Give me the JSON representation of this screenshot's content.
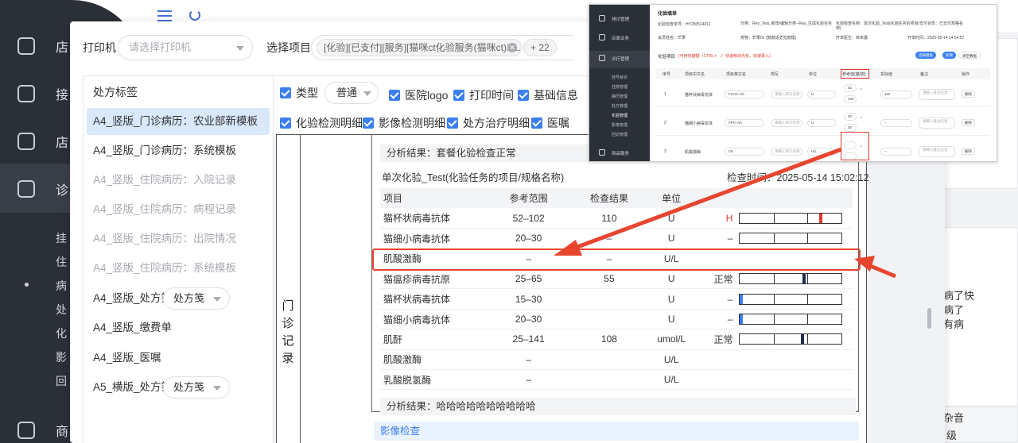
{
  "background": {
    "sidebar_items": [
      {
        "label": "店",
        "icon": "monitor-icon"
      },
      {
        "label": "接",
        "icon": "clipboard-icon"
      },
      {
        "label": "店",
        "icon": "home-icon"
      },
      {
        "label": "诊",
        "icon": "medical-kit-icon"
      }
    ],
    "sidebar_subitems": [
      "挂",
      "住",
      "病",
      "处",
      "化",
      "影",
      "回"
    ],
    "sidebar_bottom": {
      "label": "商",
      "icon": "bag-icon"
    },
    "right_texts": [
      "病了快",
      "病了",
      "有病",
      "杂音",
      "级"
    ]
  },
  "dialog": {
    "printer_label": "打印机",
    "printer_placeholder": "请选择打印机",
    "project_label": "选择项目",
    "project_tag": "[化验][已支付][服务][猫咪ct化验服务(猫咪ct)X1...",
    "project_more": "+ 22",
    "left_panel": {
      "title": "处方标签",
      "items": [
        {
          "label": "A4_竖版_门诊病历：农业部新模板",
          "state": "active"
        },
        {
          "label": "A4_竖版_门诊病历：系统模板",
          "state": "normal"
        },
        {
          "label": "A4_竖版_住院病历：入院记录",
          "state": "disabled"
        },
        {
          "label": "A4_竖版_住院病历：病程记录",
          "state": "disabled"
        },
        {
          "label": "A4_竖版_住院病历：出院情况",
          "state": "disabled"
        },
        {
          "label": "A4_竖版_住院病历：系统模板",
          "state": "disabled"
        },
        {
          "label": "A4_竖版_处方笺",
          "state": "normal",
          "select": "处方笺"
        },
        {
          "label": "A4_竖版_缴费单",
          "state": "normal"
        },
        {
          "label": "A4_竖版_医嘱",
          "state": "normal"
        },
        {
          "label": "A5_横版_处方笺",
          "state": "normal",
          "select": "处方笺"
        }
      ]
    },
    "options_row1": {
      "type_label": "类型",
      "type_value": "普通",
      "hospital_logo": "医院logo",
      "print_time": "打印时间",
      "basic_info": "基础信息"
    },
    "options_row2": {
      "lab_detail": "化验检测明细",
      "imaging_detail": "影像检测明细",
      "treatment_detail": "处方治疗明细",
      "orders": "医嘱"
    }
  },
  "preview": {
    "vertical_label": [
      "门",
      "诊",
      "记",
      "录"
    ],
    "analysis_top": "分析结果：套餐化验检查正常",
    "single_title": "单次化验_Test(化验任务的项目/规格名称)",
    "check_time": "检查时间：2025-05-14 15:02:12",
    "table_headers": {
      "name": "项目",
      "ref": "参考范围",
      "result": "检查结果",
      "unit": "单位"
    },
    "rows": [
      {
        "name": "猫杯状病毒抗体",
        "ref": "52–102",
        "result": "110",
        "unit": "U",
        "flag": "H",
        "bar": true,
        "mark_pos": 0.78,
        "mark_color": "#e03a2f"
      },
      {
        "name": "猫细小病毒抗体",
        "ref": "20–30",
        "result": "–",
        "unit": "U",
        "flag": "–",
        "bar": true,
        "mark_pos": null,
        "mark_color": ""
      },
      {
        "name": "肌酸激酶",
        "ref": "–",
        "result": "–",
        "unit": "U/L",
        "flag": "",
        "bar": false,
        "mark_pos": null,
        "mark_color": ""
      },
      {
        "name": "猫瘟疹病毒抗原",
        "ref": "25–65",
        "result": "55",
        "unit": "U",
        "flag": "正常",
        "bar": true,
        "mark_pos": 0.61,
        "mark_color": "#1f2d4d"
      },
      {
        "name": "猫杯状病毒抗体",
        "ref": "15–30",
        "result": "",
        "unit": "U",
        "flag": "–",
        "bar": true,
        "mark_pos": 0.0,
        "mark_color": "#3b7ff0"
      },
      {
        "name": "猫细小病毒抗体",
        "ref": "20–30",
        "result": "",
        "unit": "U",
        "flag": "–",
        "bar": true,
        "mark_pos": 0.0,
        "mark_color": "#3b7ff0"
      },
      {
        "name": "肌酐",
        "ref": "25–141",
        "result": "108",
        "unit": "umol/L",
        "flag": "正常",
        "bar": true,
        "mark_pos": 0.6,
        "mark_color": "#1f2d4d"
      },
      {
        "name": "肌酸激酶",
        "ref": "–",
        "result": "",
        "unit": "U/L",
        "flag": "",
        "bar": false,
        "mark_pos": null,
        "mark_color": ""
      },
      {
        "name": "乳酸脱氢酶",
        "ref": "–",
        "result": "",
        "unit": "U/L",
        "flag": "",
        "bar": false,
        "mark_pos": null,
        "mark_color": ""
      }
    ],
    "analysis_bottom": "分析结果：哈哈哈哈哈哈哈哈哈哈",
    "imaging_section": "影像检查"
  },
  "inset": {
    "sidebar": [
      "排诊管理",
      "店面业务",
      "诊疗管理",
      "商品服务"
    ],
    "sidebar_sub": [
      "挂号就诊",
      "住院管理",
      "病历管理",
      "处方管理",
      "化验管理",
      "影像管理",
      "回访管理"
    ],
    "title": "化验填单",
    "info": {
      "no": "化验检查单号：HY250514011",
      "category": "分类：Rey_Test_新增/编辑分类--Rey_生成化验任务",
      "name_label": "化验检查名称：单次化验_Test(化验任务的项目/支付状态：已支付规格名称)",
      "pet_owner": "会员姓名：芒果",
      "pet": "宠物：芒果01 (鼓鼓适史犯鼓蜡)",
      "doctor": "开单医生：西米露",
      "time": "开单时间：2025-05-14 14:54:57"
    },
    "section": "化验项目",
    "hint": "(可用快捷键（CTRL+↑ ↓）快速移动光标，快速录入)",
    "btn_template": "选择模板",
    "btn_add": "新增",
    "btn_clear": "清空数据",
    "headers": [
      "序号",
      "项目中文名",
      "项目英文名",
      "简写",
      "单位",
      "参考值(猫/狗)",
      "实际值",
      "备注",
      "操作"
    ],
    "rows": [
      {
        "idx": "1",
        "cn": "猫杯状病毒抗体",
        "en": "FCAV–Ab",
        "abbr": "请输入简写名称",
        "unit": "U",
        "ref_lo": "52",
        "ref_hi": "102",
        "val": "110",
        "note": "请输入备注信息",
        "op": "删除"
      },
      {
        "idx": "2",
        "cn": "猫细小病毒抗体",
        "en": "FPV–Ab",
        "abbr": "请输入简写名称",
        "unit": "U",
        "ref_lo": "20",
        "ref_hi": "30",
        "val": "–",
        "note": "请输入备注信息",
        "op": "删除"
      },
      {
        "idx": "3",
        "cn": "肌酸激酶",
        "en": "CK",
        "abbr": "请输入简写名称",
        "unit": "U/L",
        "ref_lo": "",
        "ref_hi": "",
        "val": "–",
        "note": "请输入备注信息",
        "op": "删除"
      }
    ]
  }
}
